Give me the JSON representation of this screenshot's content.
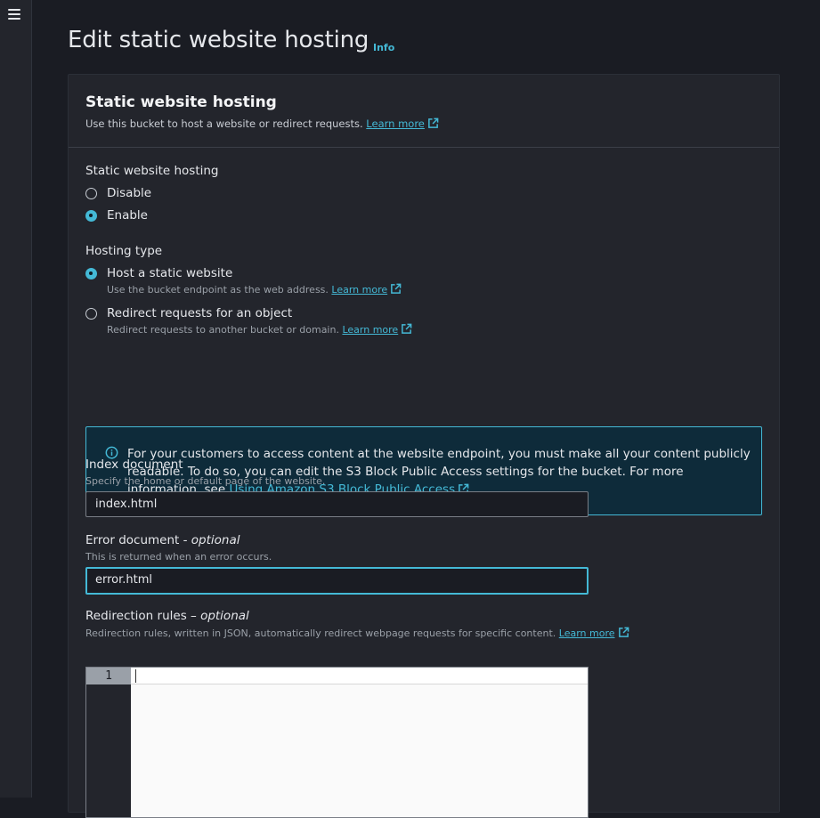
{
  "page": {
    "title": "Edit static website hosting",
    "info_label": "Info"
  },
  "container": {
    "title": "Static website hosting",
    "description": "Use this bucket to host a website or redirect requests.",
    "learn_more": "Learn more"
  },
  "hosting": {
    "label": "Static website hosting",
    "options": [
      {
        "label": "Disable",
        "checked": false
      },
      {
        "label": "Enable",
        "checked": true
      }
    ]
  },
  "hosting_type": {
    "label": "Hosting type",
    "options": [
      {
        "label": "Host a static website",
        "description": "Use the bucket endpoint as the web address.",
        "learn_more": "Learn more",
        "checked": true
      },
      {
        "label": "Redirect requests for an object",
        "description": "Redirect requests to another bucket or domain.",
        "learn_more": "Learn more",
        "checked": false
      }
    ]
  },
  "alert": {
    "text": "For your customers to access content at the website endpoint, you must make all your content publicly readable. To do so, you can edit the S3 Block Public Access settings for the bucket. For more information, see",
    "link": "Using Amazon S3 Block Public Access"
  },
  "index_document": {
    "label": "Index document",
    "description": "Specify the home or default page of the website.",
    "value": "index.html"
  },
  "error_document": {
    "label": "Error document - ",
    "label_optional": "optional",
    "description": "This is returned when an error occurs.",
    "value": "error.html"
  },
  "redirection_rules": {
    "label": "Redirection rules – ",
    "label_optional": "optional",
    "description": "Redirection rules, written in JSON, automatically redirect webpage requests for specific content.",
    "learn_more": "Learn more",
    "line_number": "1"
  },
  "colors": {
    "accent": "#44b9d6",
    "background": "#1a1c23",
    "panel": "#23252c",
    "alert_bg": "#0e2b3a"
  }
}
